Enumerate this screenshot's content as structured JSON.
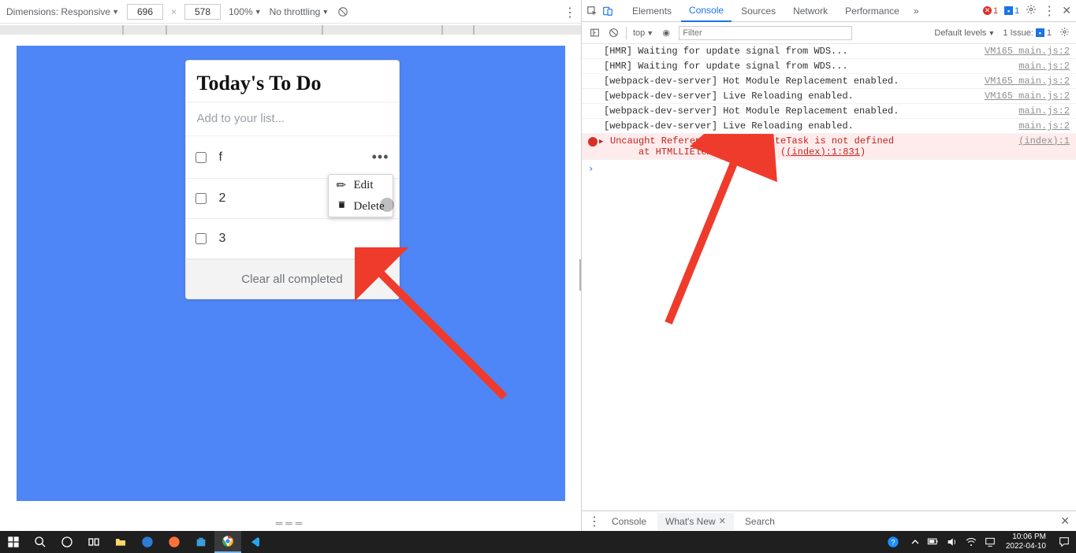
{
  "device_toolbar": {
    "dimensions_label": "Dimensions: Responsive",
    "width": "696",
    "height": "578",
    "zoom": "100%",
    "throttling": "No throttling"
  },
  "todo": {
    "title": "Today's To Do",
    "placeholder": "Add to your list...",
    "tasks": [
      "f",
      "2",
      "3"
    ],
    "ctx": {
      "edit": "Edit",
      "delete": "Delete"
    },
    "clear": "Clear all completed"
  },
  "devtools": {
    "tabs": [
      "Elements",
      "Console",
      "Sources",
      "Network",
      "Performance"
    ],
    "active_tab": "Console",
    "error_count": "1",
    "msg_count": "1",
    "console_toolbar": {
      "context": "top",
      "filter_ph": "Filter",
      "levels": "Default levels",
      "issues_label": "1 Issue:",
      "issues_count": "1"
    },
    "messages": [
      {
        "type": "log",
        "text": "[HMR] Waiting for update signal from WDS...",
        "src": "VM165 main.js:2"
      },
      {
        "type": "log",
        "text": "[HMR] Waiting for update signal from WDS...",
        "src": "main.js:2"
      },
      {
        "type": "log",
        "text": "[webpack-dev-server] Hot Module Replacement enabled.",
        "src": "VM165 main.js:2"
      },
      {
        "type": "log",
        "text": "[webpack-dev-server] Live Reloading enabled.",
        "src": "VM165 main.js:2"
      },
      {
        "type": "log",
        "text": "[webpack-dev-server] Hot Module Replacement enabled.",
        "src": "main.js:2"
      },
      {
        "type": "log",
        "text": "[webpack-dev-server] Live Reloading enabled.",
        "src": "main.js:2"
      }
    ],
    "error": {
      "line1": "Uncaught ReferenceError: deleteTask is not defined",
      "line2_pre": "at HTMLLIElement.onclick (",
      "line2_link": "(index):1:831",
      "line2_post": ")",
      "src": "(index):1"
    },
    "drawer": {
      "tabs": [
        "Console",
        "What's New",
        "Search"
      ],
      "active": "What's New"
    }
  },
  "taskbar": {
    "time": "10:06 PM",
    "date": "2022-04-10"
  }
}
